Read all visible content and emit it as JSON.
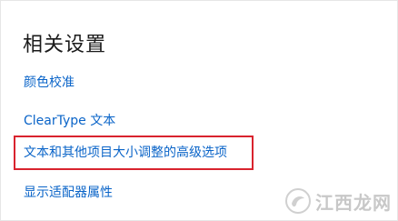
{
  "section": {
    "title": "相关设置"
  },
  "links": [
    {
      "label": "颜色校准"
    },
    {
      "label": "ClearType 文本"
    },
    {
      "label": "文本和其他项目大小调整的高级选项"
    },
    {
      "label": "显示适配器属性"
    }
  ],
  "highlight": {
    "color": "#d9232e"
  },
  "watermark": {
    "text": "江西龙网",
    "icon": "dragon-logo-icon"
  },
  "colors": {
    "link": "#0a64c8",
    "title": "#1a1a1a",
    "background": "#ffffff"
  }
}
